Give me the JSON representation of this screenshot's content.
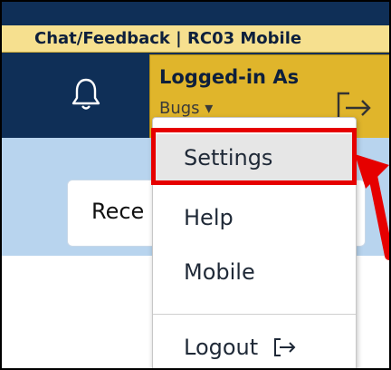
{
  "header": {
    "chat_tab": "Chat/Feedback | RC03 Mobile",
    "logged_in_label": "Logged-in As",
    "user_name": "Bugs",
    "user_caret": "▾"
  },
  "main": {
    "recent_label": "Rece"
  },
  "user_menu": {
    "items": [
      {
        "label": "Settings",
        "highlighted": true
      },
      {
        "label": "Help"
      },
      {
        "label": "Mobile"
      }
    ],
    "logout_label": "Logout"
  },
  "icons": {
    "bell": "bell-icon",
    "exit": "sign-out-icon",
    "logout": "logout-icon"
  },
  "colors": {
    "navbar": "#0f2f57",
    "chat_tab": "#f6e08f",
    "user_box": "#e0b52b",
    "light_band": "#b8d4ee",
    "highlight": "#e60000"
  }
}
